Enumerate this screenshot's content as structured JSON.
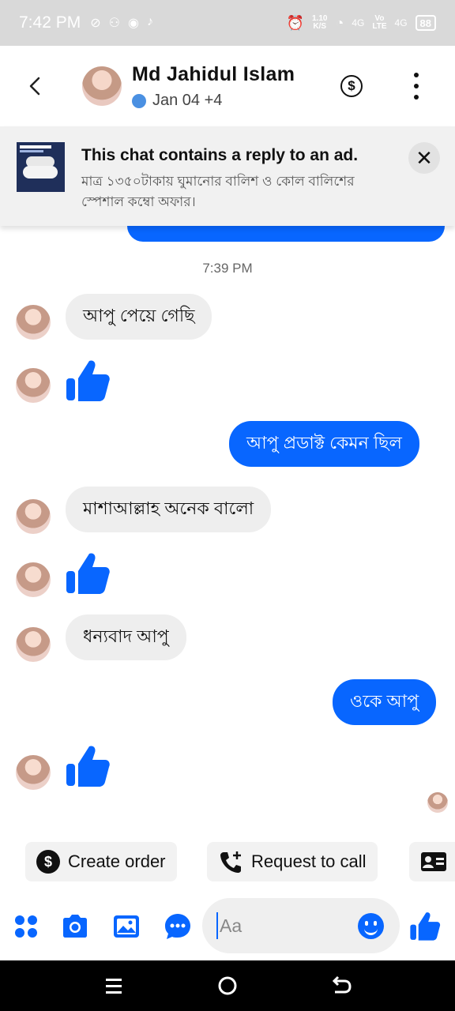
{
  "status_bar": {
    "time": "7:42 PM",
    "net_speed_value": "1.10",
    "net_speed_unit": "K/S",
    "signal1": "4G",
    "volte_top": "Vo",
    "volte_bottom": "LTE",
    "signal2": "4G",
    "battery": "88"
  },
  "header": {
    "contact_name": "Md Jahidul Islam",
    "subtitle": "Jan 04 +4",
    "dollar_symbol": "$"
  },
  "ad_banner": {
    "title": "This chat contains a reply to an ad.",
    "subtitle": "মাত্র ১৩৫০টাকায় ঘুমানোর বালিশ ও কোল বালিশের স্পেশাল কম্বো অফার।",
    "close_symbol": "✕"
  },
  "messages": {
    "timestamp": "7:39 PM",
    "m1": "আপু পেয়ে গেছি",
    "m2": "আপু প্রডাক্ট কেমন ছিল",
    "m3": "মাশাআল্লাহ অনেক বালো",
    "m4": "ধন্যবাদ আপু",
    "m5": "ওকে আপু"
  },
  "quick_replies": {
    "create_order": "Create order",
    "request_call": "Request to call"
  },
  "composer": {
    "placeholder": "Aa"
  },
  "colors": {
    "accent": "#0866ff",
    "bubble_incoming": "#eeeeee",
    "status_bar": "#d9d9d9"
  }
}
